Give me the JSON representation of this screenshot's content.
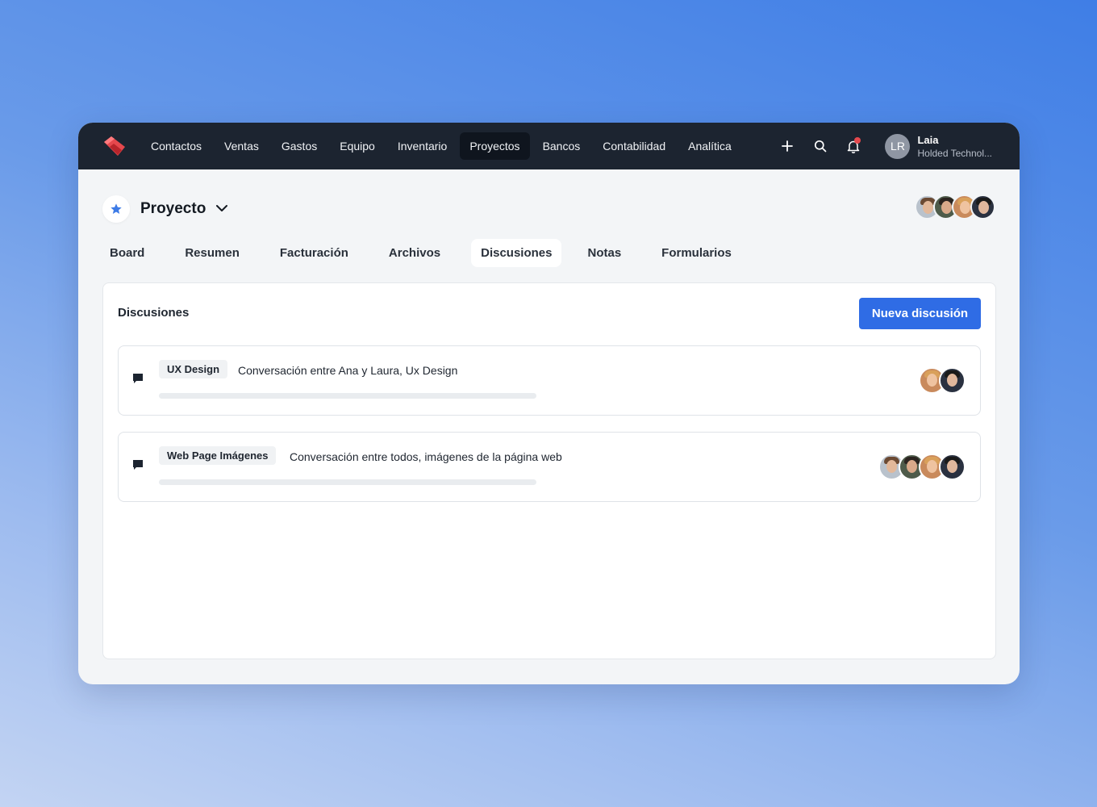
{
  "nav": {
    "items": [
      {
        "label": "Contactos",
        "active": false
      },
      {
        "label": "Ventas",
        "active": false
      },
      {
        "label": "Gastos",
        "active": false
      },
      {
        "label": "Equipo",
        "active": false
      },
      {
        "label": "Inventario",
        "active": false
      },
      {
        "label": "Proyectos",
        "active": true
      },
      {
        "label": "Bancos",
        "active": false
      },
      {
        "label": "Contabilidad",
        "active": false
      },
      {
        "label": "Analítica",
        "active": false
      }
    ],
    "icons": [
      "plus-icon",
      "search-icon",
      "bell-icon"
    ]
  },
  "user": {
    "initials": "LR",
    "name": "Laia",
    "company": "Holded Technol..."
  },
  "project": {
    "title": "Proyecto"
  },
  "tabs": [
    {
      "label": "Board",
      "active": false
    },
    {
      "label": "Resumen",
      "active": false
    },
    {
      "label": "Facturación",
      "active": false
    },
    {
      "label": "Archivos",
      "active": false
    },
    {
      "label": "Discusiones",
      "active": true
    },
    {
      "label": "Notas",
      "active": false
    },
    {
      "label": "Formularios",
      "active": false
    }
  ],
  "panel": {
    "title": "Discusiones",
    "new_button": "Nueva discusión",
    "discussions": [
      {
        "tag": "UX Design",
        "text": "Conversación entre Ana y Laura, Ux Design",
        "participants": 2
      },
      {
        "tag": "Web Page Imágenes",
        "text": "Conversación entre todos, imágenes de la página web",
        "participants": 4
      }
    ]
  },
  "colors": {
    "topbar": "#1c2430",
    "accent": "#2f6ce5",
    "logo": "#e5484d",
    "star": "#3d7be6"
  }
}
